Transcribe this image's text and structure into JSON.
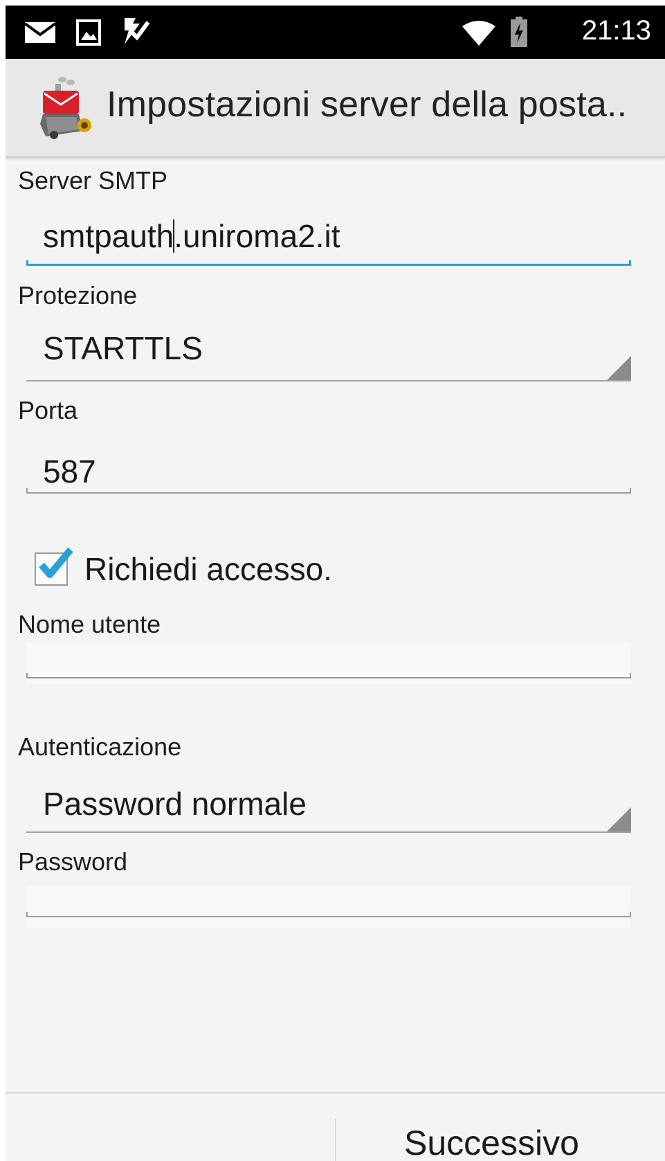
{
  "status_bar": {
    "time": "21:13",
    "icons": [
      "mail-icon",
      "image-icon",
      "task-check-icon",
      "wifi-icon",
      "battery-charging-icon"
    ]
  },
  "action_bar": {
    "title": "Impostazioni server della posta..",
    "app_icon": "email-app-icon"
  },
  "form": {
    "smtp_server": {
      "label": "Server SMTP",
      "value_before_caret": "smtpauth",
      "value_after_caret": ".uniroma2.it"
    },
    "security": {
      "label": "Protezione",
      "value": "STARTTLS"
    },
    "port": {
      "label": "Porta",
      "value": "587"
    },
    "require_signin": {
      "label": "Richiedi accesso.",
      "checked": true
    },
    "username": {
      "label": "Nome utente",
      "value": ""
    },
    "authentication": {
      "label": "Autenticazione",
      "value": "Password normale"
    },
    "password": {
      "label": "Password",
      "value": ""
    }
  },
  "buttons": {
    "previous_label": "",
    "next_label": "Successivo"
  },
  "colors": {
    "accent": "#2aa1d6",
    "status_bar": "#000000",
    "action_bar": "#e8e8e8",
    "background": "#f4f4f4"
  }
}
